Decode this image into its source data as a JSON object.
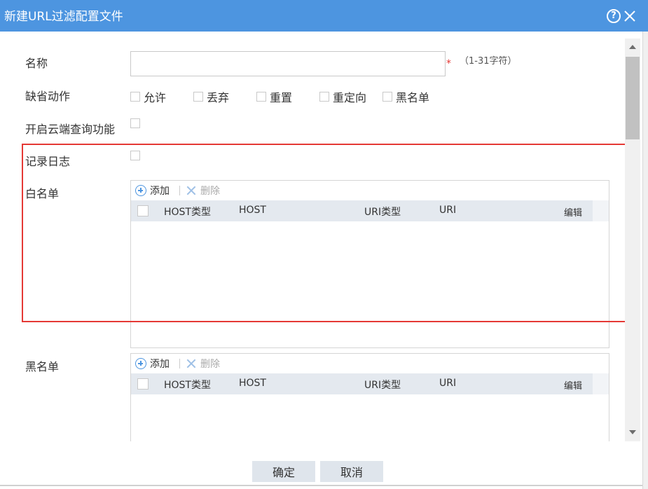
{
  "dialog": {
    "title": "新建URL过滤配置文件",
    "help_icon": "?",
    "close_icon": "close-icon"
  },
  "form": {
    "name": {
      "label": "名称",
      "value": "",
      "placeholder": "",
      "required_mark": "*",
      "hint": "（1-31字符）"
    },
    "default_action": {
      "label": "缺省动作",
      "options": [
        {
          "label": "允许",
          "checked": false
        },
        {
          "label": "丢弃",
          "checked": false
        },
        {
          "label": "重置",
          "checked": false
        },
        {
          "label": "重定向",
          "checked": false
        },
        {
          "label": "黑名单",
          "checked": false
        }
      ]
    },
    "cloud_query": {
      "label": "开启云端查询功能",
      "checked": false
    },
    "log": {
      "label": "记录日志",
      "checked": false
    }
  },
  "whitelist": {
    "label": "白名单",
    "toolbar": {
      "add": "添加",
      "delete": "删除"
    },
    "columns": [
      "HOST类型",
      "HOST",
      "URI类型",
      "URI",
      "编辑"
    ],
    "rows": []
  },
  "blacklist": {
    "label": "黑名单",
    "toolbar": {
      "add": "添加",
      "delete": "删除"
    },
    "columns": [
      "HOST类型",
      "HOST",
      "URI类型",
      "URI",
      "编辑"
    ],
    "rows": []
  },
  "footer": {
    "ok": "确定",
    "cancel": "取消"
  },
  "colors": {
    "titlebar": "#4d95e0",
    "table_header": "#e4e9ef",
    "highlight": "#e53935",
    "button": "#dfe5ec"
  }
}
